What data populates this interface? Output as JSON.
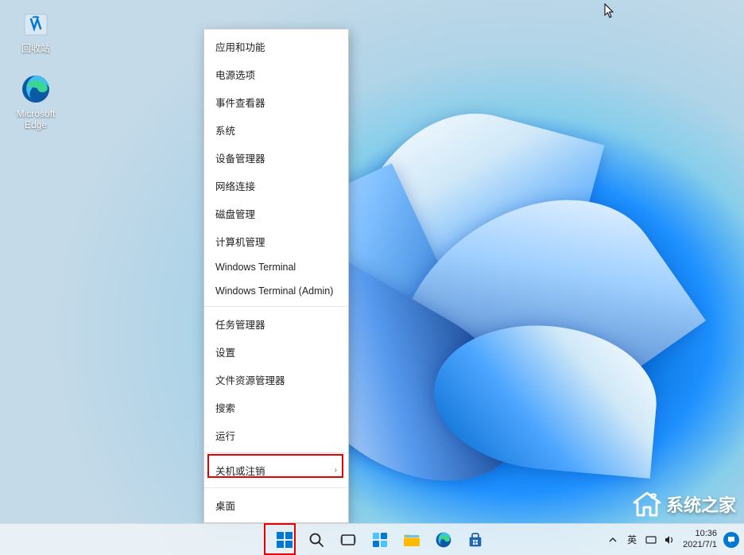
{
  "desktop": {
    "recycle_bin": "回收站",
    "edge": "Microsoft Edge"
  },
  "context_menu": {
    "items": [
      {
        "label": "应用和功能",
        "id": "apps-features",
        "sep_after": false
      },
      {
        "label": "电源选项",
        "id": "power-options",
        "sep_after": false
      },
      {
        "label": "事件查看器",
        "id": "event-viewer",
        "sep_after": false
      },
      {
        "label": "系统",
        "id": "system",
        "sep_after": false
      },
      {
        "label": "设备管理器",
        "id": "device-manager",
        "sep_after": false
      },
      {
        "label": "网络连接",
        "id": "network-connections",
        "sep_after": false
      },
      {
        "label": "磁盘管理",
        "id": "disk-management",
        "sep_after": false
      },
      {
        "label": "计算机管理",
        "id": "computer-management",
        "sep_after": false
      },
      {
        "label": "Windows Terminal",
        "id": "windows-terminal",
        "sep_after": false
      },
      {
        "label": "Windows Terminal (Admin)",
        "id": "windows-terminal-admin",
        "sep_after": true
      },
      {
        "label": "任务管理器",
        "id": "task-manager",
        "sep_after": false
      },
      {
        "label": "设置",
        "id": "settings",
        "sep_after": false
      },
      {
        "label": "文件资源管理器",
        "id": "file-explorer",
        "sep_after": false
      },
      {
        "label": "搜索",
        "id": "search",
        "sep_after": false
      },
      {
        "label": "运行",
        "id": "run",
        "sep_after": true
      },
      {
        "label": "关机或注销",
        "id": "shutdown-signout",
        "submenu": true,
        "sep_after": true
      },
      {
        "label": "桌面",
        "id": "desktop",
        "sep_after": false
      }
    ]
  },
  "systray": {
    "ime": "英",
    "time": "10:36",
    "date": "2021/7/1"
  },
  "watermark": {
    "text": "系统之家"
  }
}
